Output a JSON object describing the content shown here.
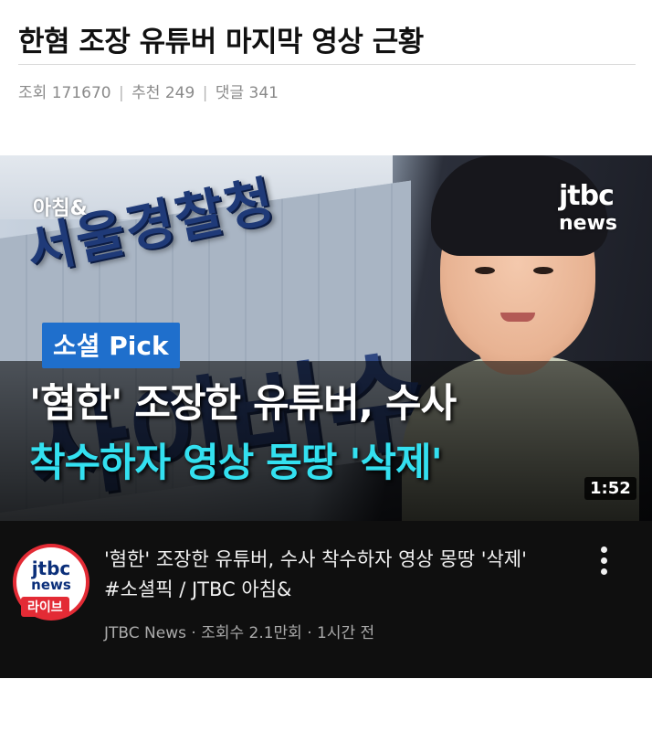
{
  "post": {
    "title": "한혐 조장 유튜버 마지막 영상 근황",
    "views_label": "조회",
    "views": "171670",
    "likes_label": "추천",
    "likes": "249",
    "comments_label": "댓글",
    "comments": "341",
    "separator": "|"
  },
  "video": {
    "thumbnail": {
      "show_logo": "아침&",
      "sign_text": "서울경찰청",
      "sign_text_2": "사이버수",
      "network_logo": "jtbc",
      "network_logo_sub": "news",
      "badge": "소셜 Pick",
      "caption_line1": "'혐한' 조장한 유튜버, 수사",
      "caption_line2": "착수하자 영상 몽땅 '삭제'",
      "caption_line2_color": "#33e0f0",
      "badge_color": "#1f6fcc"
    },
    "duration": "1:52",
    "title": "'혐한' 조장한 유튜버, 수사 착수하자 영상 몽땅 '삭제' #소셜픽 / JTBC 아침&",
    "channel_avatar": {
      "logo": "jtbc",
      "logo_sub": "news",
      "live_badge": "라이브",
      "ring_color": "#e32b35"
    },
    "meta": "JTBC News · 조회수 2.1만회 · 1시간 전",
    "menu_icon": "more-vert-icon"
  }
}
